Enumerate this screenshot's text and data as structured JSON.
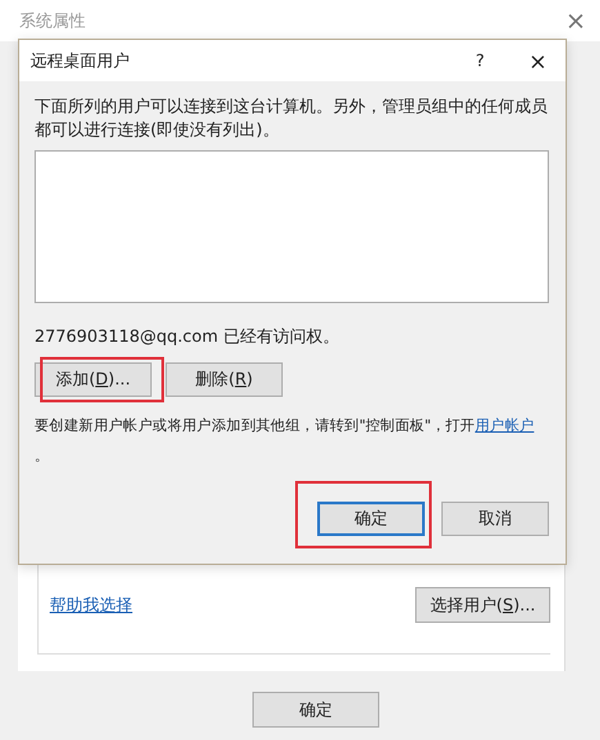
{
  "window": {
    "title": "系统属性",
    "close": "×"
  },
  "dialog": {
    "title": "远程桌面用户",
    "help": "?",
    "close": "×",
    "description": "下面所列的用户可以连接到这台计算机。另外，管理员组中的任何成员都可以进行连接(即使没有列出)。",
    "access_note": "2776903118@qq.com 已经有访问权。",
    "user_buttons": [
      {
        "before": "添加(",
        "key": "D",
        "after": ")...",
        "highlighted": true
      },
      {
        "before": "删除(",
        "key": "R",
        "after": ")",
        "highlighted": false
      }
    ],
    "hint": "要创建新用户帐户或将用户添加到其他组，请转到\"控制面板\"，打开",
    "hint_link": "用户帐户",
    "hint_end": "。",
    "buttons": [
      {
        "label": "确定",
        "default": true,
        "highlighted": true
      },
      {
        "label": "取消",
        "default": false,
        "highlighted": false
      }
    ]
  },
  "parent": {
    "help_link": "帮助我选择",
    "select_button": {
      "before": "选择用户(",
      "key": "S",
      "after": ")..."
    },
    "buttons": [
      {
        "label": "确定"
      }
    ]
  }
}
